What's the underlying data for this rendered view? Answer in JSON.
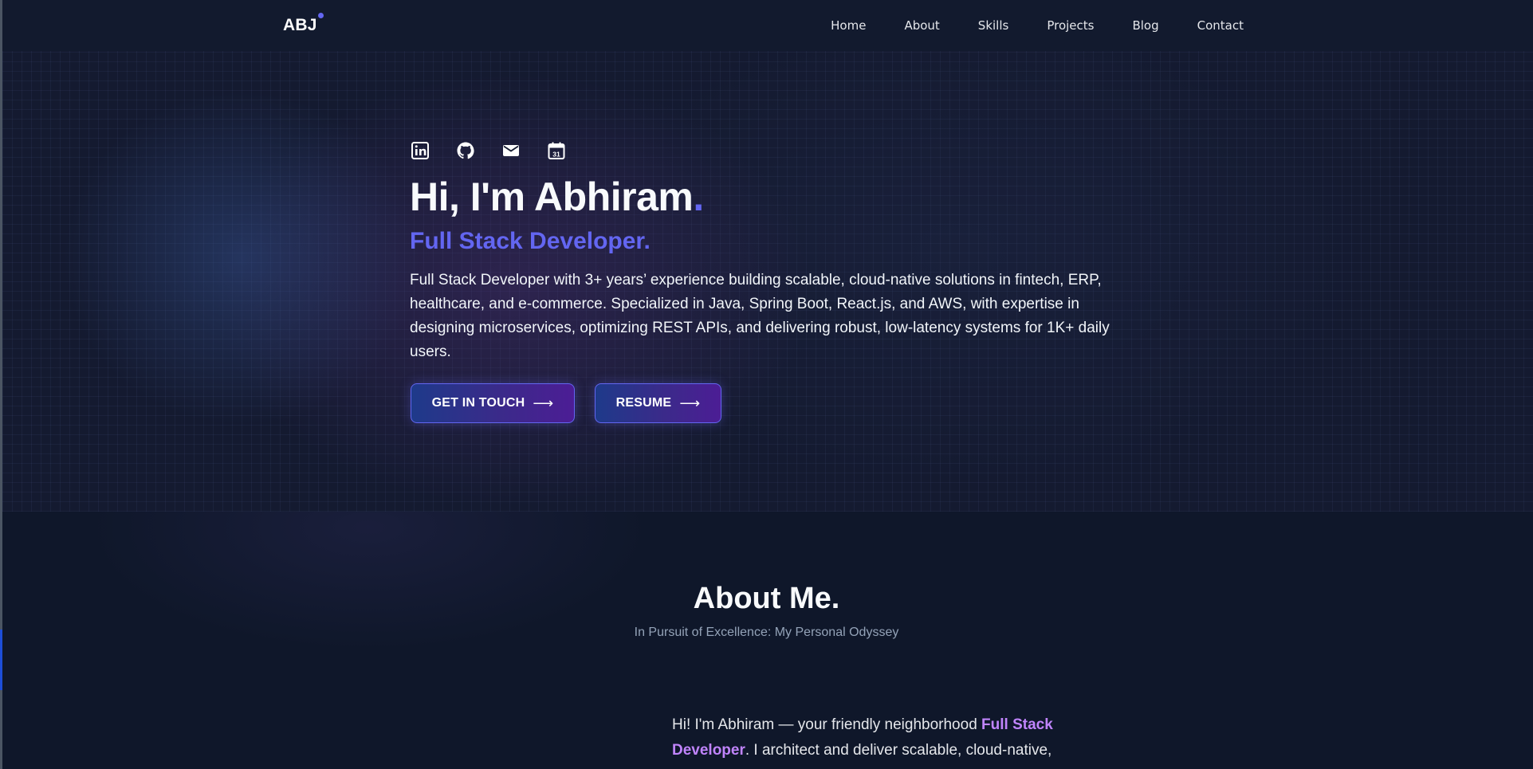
{
  "nav": {
    "logo": "ABJ",
    "links": [
      "Home",
      "About",
      "Skills",
      "Projects",
      "Blog",
      "Contact"
    ]
  },
  "hero": {
    "socials": [
      "linkedin-icon",
      "github-icon",
      "mail-icon",
      "calendar-icon"
    ],
    "calendar_day": "31",
    "title": "Hi, I'm Abhiram",
    "title_dot": ".",
    "role": "Full Stack Developer.",
    "description": "Full Stack Developer with 3+ years’ experience building scalable, cloud-native solutions in fintech, ERP, healthcare, and e-commerce. Specialized in Java, Spring Boot, React.js, and AWS, with expertise in designing microservices, optimizing REST APIs, and delivering robust, low-latency systems for 1K+ daily users.",
    "buttons": {
      "contact": "GET IN TOUCH",
      "resume": "RESUME",
      "arrow": "⟶"
    }
  },
  "about": {
    "title": "About Me.",
    "subtitle": "In Pursuit of Excellence: My Personal Odyssey",
    "intro_start": "Hi! I'm Abhiram — your friendly neighborhood ",
    "intro_highlight": "Full Stack Developer",
    "intro_end": ". I architect and deliver scalable, cloud-native,"
  },
  "colors": {
    "accent": "#6366f1",
    "highlight": "#c084fc",
    "background": "#0f172a"
  }
}
